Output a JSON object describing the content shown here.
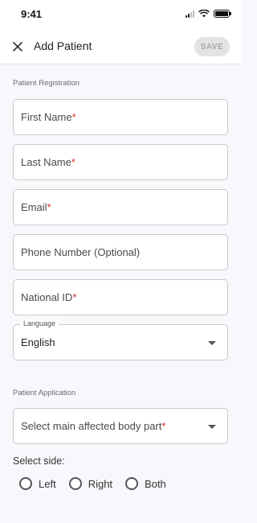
{
  "status_bar": {
    "time": "9:41"
  },
  "app_bar": {
    "title": "Add Patient",
    "save_label": "SAVE"
  },
  "registration": {
    "section_title": "Patient Registration",
    "fields": {
      "first_name": {
        "label": "First Name",
        "required": "*"
      },
      "last_name": {
        "label": "Last Name",
        "required": "*"
      },
      "email": {
        "label": "Email",
        "required": "*"
      },
      "phone": {
        "label": "Phone Number (Optional)"
      },
      "national_id": {
        "label": "National ID",
        "required": "*"
      }
    },
    "language": {
      "label": "Language",
      "value": "English"
    }
  },
  "application": {
    "section_title": "Patient Application",
    "body_part": {
      "placeholder": "Select main affected body part",
      "required": "*"
    },
    "side": {
      "label": "Select side:",
      "options": [
        "Left",
        "Right",
        "Both"
      ]
    }
  },
  "colors": {
    "required": "#d32f2f",
    "background": "#f7f8fc",
    "save_disabled": "#e3e3e3"
  }
}
